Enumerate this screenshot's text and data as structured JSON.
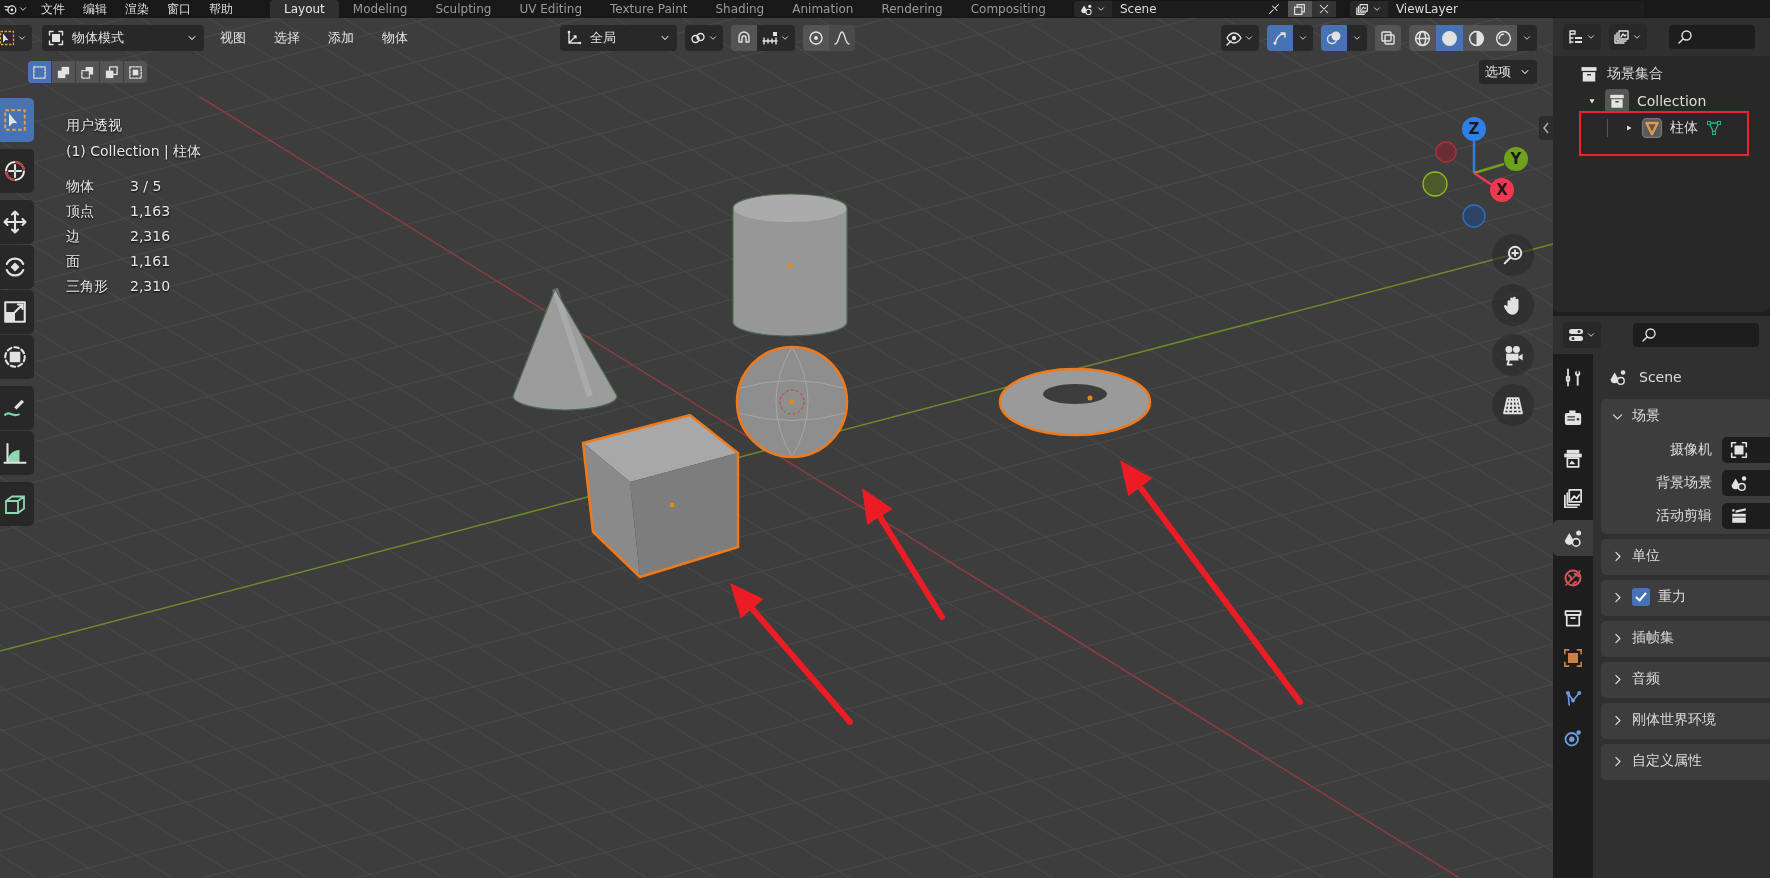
{
  "top_bar": {
    "menus": [
      "文件",
      "编辑",
      "渲染",
      "窗口",
      "帮助"
    ],
    "workspaces": [
      {
        "label": "Layout",
        "selected": true
      },
      {
        "label": "Modeling",
        "selected": false
      },
      {
        "label": "Sculpting",
        "selected": false
      },
      {
        "label": "UV Editing",
        "selected": false
      },
      {
        "label": "Texture Paint",
        "selected": false
      },
      {
        "label": "Shading",
        "selected": false
      },
      {
        "label": "Animation",
        "selected": false
      },
      {
        "label": "Rendering",
        "selected": false
      },
      {
        "label": "Compositing",
        "selected": false
      }
    ],
    "scene": "Scene",
    "view_layer": "ViewLayer"
  },
  "viewport_header": {
    "mode": "物体模式",
    "menus": [
      "视图",
      "选择",
      "添加",
      "物体"
    ],
    "orientation": "全局",
    "gizmos_on": true,
    "overlays_on": true,
    "xray_on": false,
    "shading": [
      {
        "kind": "wireframe",
        "selected": false
      },
      {
        "kind": "solid",
        "selected": true
      },
      {
        "kind": "material",
        "selected": false
      },
      {
        "kind": "rendered",
        "selected": false
      }
    ]
  },
  "select_modes": [
    {
      "kind": "new",
      "selected": true
    },
    {
      "kind": "extend",
      "selected": false
    },
    {
      "kind": "subtract",
      "selected": false
    },
    {
      "kind": "invert",
      "selected": false
    },
    {
      "kind": "intersect",
      "selected": false
    }
  ],
  "options_menu": "选项",
  "tools": [
    {
      "kind": "select",
      "selected": true
    },
    {
      "kind": "cursor",
      "selected": false
    },
    {
      "kind": "move",
      "selected": false
    },
    {
      "kind": "rotate",
      "selected": false
    },
    {
      "kind": "scale",
      "selected": false
    },
    {
      "kind": "transform",
      "selected": false
    },
    {
      "kind": "annotate",
      "selected": false
    },
    {
      "kind": "measure",
      "selected": false
    },
    {
      "kind": "add_cube",
      "selected": false
    }
  ],
  "overlay": {
    "view_name": "用户透视",
    "context": "(1) Collection | 柱体",
    "stats": [
      {
        "label": "物体",
        "value": "3 / 5"
      },
      {
        "label": "顶点",
        "value": "1,163"
      },
      {
        "label": "边",
        "value": "2,316"
      },
      {
        "label": "面",
        "value": "1,161"
      },
      {
        "label": "三角形",
        "value": "2,310"
      }
    ]
  },
  "objects": [
    {
      "kind": "cone",
      "selected": false
    },
    {
      "kind": "cylinder",
      "selected": false
    },
    {
      "kind": "sphere",
      "selected": true
    },
    {
      "kind": "cube",
      "selected": true
    },
    {
      "kind": "torus",
      "selected": true
    }
  ],
  "gizmo_axes": [
    {
      "label": "Z",
      "color": "#2e80e8"
    },
    {
      "label": "Y",
      "color": "#6ea11c"
    },
    {
      "label": "X",
      "color": "#f2384f"
    }
  ],
  "outliner": {
    "tree": [
      {
        "label": "场景集合",
        "kind": "scene_collection",
        "children": [
          {
            "label": "Collection",
            "kind": "collection",
            "expanded": true,
            "children": [
              {
                "label": "柱体",
                "kind": "mesh_object",
                "expanded": false,
                "marked": true
              }
            ]
          }
        ]
      }
    ]
  },
  "properties": {
    "tabs": [
      {
        "kind": "tool",
        "selected": false
      },
      {
        "kind": "render",
        "selected": false
      },
      {
        "kind": "output",
        "selected": false
      },
      {
        "kind": "view_layer",
        "selected": false
      },
      {
        "kind": "scene",
        "selected": true
      },
      {
        "kind": "world",
        "selected": false
      },
      {
        "kind": "collection",
        "selected": false
      },
      {
        "kind": "object",
        "selected": false
      },
      {
        "kind": "constraints",
        "selected": false
      },
      {
        "kind": "physics",
        "selected": false
      }
    ],
    "title": "Scene",
    "panels": [
      {
        "label": "场景",
        "kind": "plain",
        "expanded": true,
        "fields": [
          {
            "label": "摄像机",
            "kind": "camera"
          },
          {
            "label": "背景场景",
            "kind": "scene"
          },
          {
            "label": "活动剪辑",
            "kind": "clip"
          }
        ]
      },
      {
        "label": "单位",
        "kind": "plain",
        "expanded": false
      },
      {
        "label": "重力",
        "kind": "checkbox",
        "checked": true,
        "expanded": false
      },
      {
        "label": "插帧集",
        "kind": "plain",
        "expanded": false
      },
      {
        "label": "音频",
        "kind": "plain",
        "expanded": false
      },
      {
        "label": "刚体世界环境",
        "kind": "plain",
        "expanded": false
      },
      {
        "label": "自定义属性",
        "kind": "plain",
        "expanded": false
      }
    ]
  }
}
